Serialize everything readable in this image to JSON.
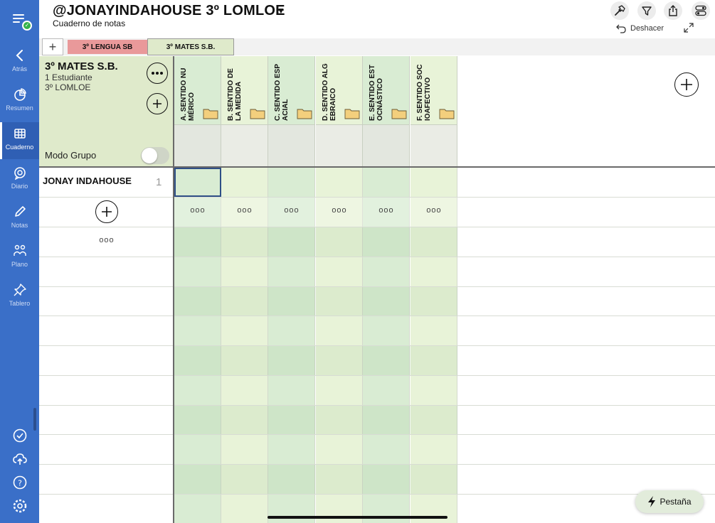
{
  "sidebar": {
    "items": [
      {
        "label": "Atrás",
        "icon": "chevron-left-icon"
      },
      {
        "label": "Resumen",
        "icon": "pie-chart-icon"
      },
      {
        "label": "Cuaderno",
        "icon": "grid-icon"
      },
      {
        "label": "Diario",
        "icon": "speech-bubble-icon"
      },
      {
        "label": "Notas",
        "icon": "pencil-icon"
      },
      {
        "label": "Plano",
        "icon": "people-icon"
      },
      {
        "label": "Tablero",
        "icon": "pin-icon"
      }
    ],
    "active": "Cuaderno",
    "accent": "#3a6fc8"
  },
  "header": {
    "title": "@JONAYINDAHOUSE 3º LOMLOE",
    "subtitle": "Cuaderno de notas",
    "undo_label": "Deshacer"
  },
  "tabs": {
    "add": "+",
    "items": [
      {
        "label": "3º LENGUA SB",
        "color": "#e9999a"
      },
      {
        "label": "3º MATES S.B.",
        "color": "#dfeacb",
        "selected": true
      }
    ]
  },
  "group": {
    "name": "3º MATES S.B.",
    "students_count": "1 Estudiante",
    "course": "3º LOMLOE",
    "mode_label": "Modo Grupo",
    "mode_on": false
  },
  "columns": [
    {
      "label": "A. SENTIDO NUMÉRICO"
    },
    {
      "label": "B. SENTIDO DE LA MEDIDA"
    },
    {
      "label": "C. SENTIDO ESPACIAL"
    },
    {
      "label": "D. SENTIDO ALGEBRAICO"
    },
    {
      "label": "E. SENTIDO ESTOCNÁSTICO"
    },
    {
      "label": "F. SENTIDO SOCIOAFECTIVO"
    }
  ],
  "students": [
    {
      "name": "JONAY INDAHOUSE",
      "number": "1"
    }
  ],
  "more_dots": "ooo",
  "pestana_label": "Pestaña"
}
